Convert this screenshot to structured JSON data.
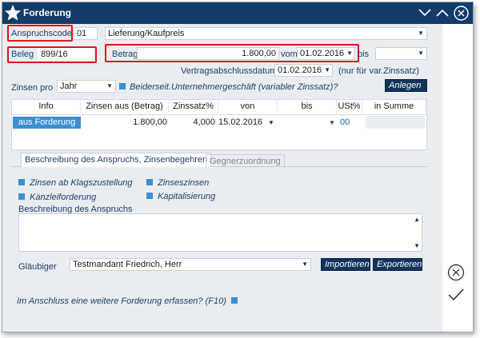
{
  "window": {
    "title": "Forderung"
  },
  "anspruch": {
    "label": "Anspruchscode",
    "code": "01",
    "description": "Lieferung/Kaufpreis"
  },
  "beleg": {
    "label": "Beleg",
    "value": "899/16"
  },
  "betrag": {
    "label": "Betrag",
    "value": "1.800,00",
    "vom_label": "vom",
    "vom_date": "01.02.2016",
    "bis_label": "bis",
    "bis_value": ""
  },
  "vertrag": {
    "label": "Vertragsabschlussdatum",
    "date": "01.02.2016",
    "note": "(nur für var.Zinssatz)"
  },
  "zinsen": {
    "label": "Zinsen pro",
    "period": "Jahr",
    "checkbox_label": "Beiderseit.Unternehmergeschäft (variabler Zinssatz)?",
    "anlegen_label": "Anlegen"
  },
  "table": {
    "headers": [
      "Info",
      "Zinsen aus (Betrag)",
      "Zinssatz%",
      "von",
      "bis",
      "USt%",
      "in Summe"
    ],
    "rows": [
      {
        "info": "aus Forderung",
        "betrag": "1.800,00",
        "zinssatz": "4,000",
        "von": "15.02.2016",
        "bis": "",
        "ust": "00",
        "summe": ""
      }
    ]
  },
  "tabs": [
    {
      "label": "Beschreibung des Anspruchs, Zinsenbegehren"
    },
    {
      "label": "Gegnerzuordnung"
    }
  ],
  "options": [
    {
      "label": "Zinsen ab Klagszustellung"
    },
    {
      "label": "Zinseszinsen"
    },
    {
      "label": "Kanzleiforderung"
    },
    {
      "label": "Kapitalisierung"
    }
  ],
  "beschreibung": {
    "label": "Beschreibung des Anspruchs",
    "text": ""
  },
  "glaeubiger": {
    "label": "Gläubiger",
    "value": "Testmandant Friedrich, Herr",
    "import_label": "Importieren",
    "export_label": "Exportieren"
  },
  "footer": {
    "question": "Im Anschluss eine weitere Forderung erfassen? (F10)"
  },
  "colors": {
    "titlebar": "#133c69",
    "accent": "#3a8fd0",
    "highlight": "#e0141b",
    "button": "#13335d"
  }
}
